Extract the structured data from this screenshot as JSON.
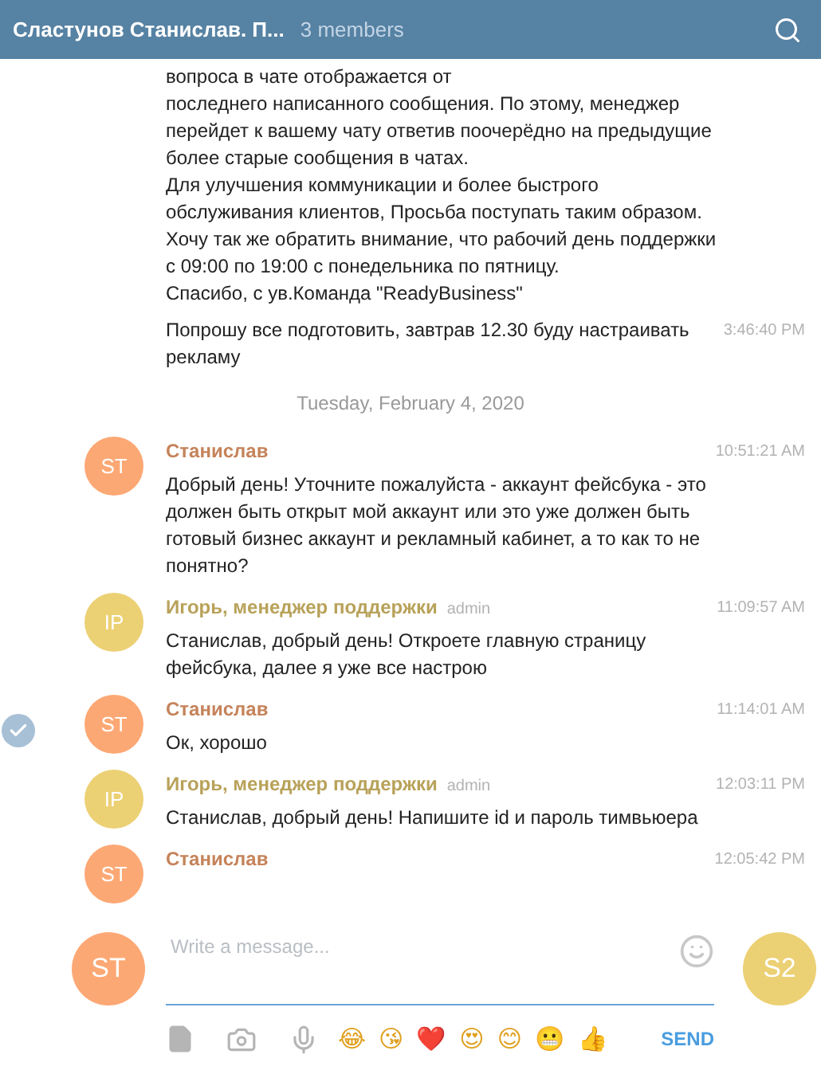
{
  "header": {
    "title": "Сластунов Станислав. П...",
    "members": "3 members"
  },
  "feed": [
    {
      "kind": "continuation",
      "text": "вопроса в чате отображается от\nпоследнего написанного сообщения. По этому, менеджер перейдет к вашему чату ответив поочерёдно на предыдущие более старые сообщения в чатах.\nДля улучшения коммуникации и более быстрого обслуживания клиентов, Просьба поступать таким образом.\nХочу так же обратить внимание, что рабочий день поддержки с 09:00 по 19:00 с понедельника по пятницу.\nСпасибо, с ув.Команда \"ReadyBusiness\""
    },
    {
      "kind": "continuation",
      "text": "Попрошу все подготовить, завтрав 12.30 буду настраивать рекламу",
      "time": "3:46:40 PM"
    },
    {
      "kind": "date",
      "text": "Tuesday, February 4, 2020"
    },
    {
      "kind": "message",
      "initials": "ST",
      "color": "#fca874",
      "name": "Станислав",
      "time": "10:51:21 AM",
      "text": "Добрый день! Уточните пожалуйста - аккаунт фейсбука - это должен быть открыт мой аккаунт или это уже должен быть готовый бизнес аккаунт и рекламный кабинет, а то как то не понятно?",
      "selected": false
    },
    {
      "kind": "message",
      "initials": "IP",
      "color": "#ecd074",
      "name": "Игорь, менеджер поддержки",
      "badge": "admin",
      "time": "11:09:57 AM",
      "text": "Станислав, добрый день! Откроете главную страницу фейсбука, далее я уже все настрою",
      "selected": false
    },
    {
      "kind": "message",
      "initials": "ST",
      "color": "#fca874",
      "name": "Станислав",
      "time": "11:14:01 AM",
      "text": "Ок, хорошо",
      "selected": true
    },
    {
      "kind": "message",
      "initials": "IP",
      "color": "#ecd074",
      "name": "Игорь, менеджер поддержки",
      "badge": "admin",
      "time": "12:03:11 PM",
      "text": "Станислав, добрый день! Напишите id и пароль тимвьюера",
      "selected": false
    },
    {
      "kind": "message",
      "initials": "ST",
      "color": "#fca874",
      "name": "Станислав",
      "time": "12:05:42 PM",
      "selected": false
    }
  ],
  "composer": {
    "self": {
      "initials": "ST",
      "color": "#fca874"
    },
    "placeholder": "Write a message...",
    "peer": {
      "initials": "S2",
      "color": "#ecd074"
    },
    "emoji": [
      "😂",
      "😘",
      "❤️",
      "😍",
      "😊",
      "😬",
      "👍"
    ],
    "send": "SEND"
  }
}
